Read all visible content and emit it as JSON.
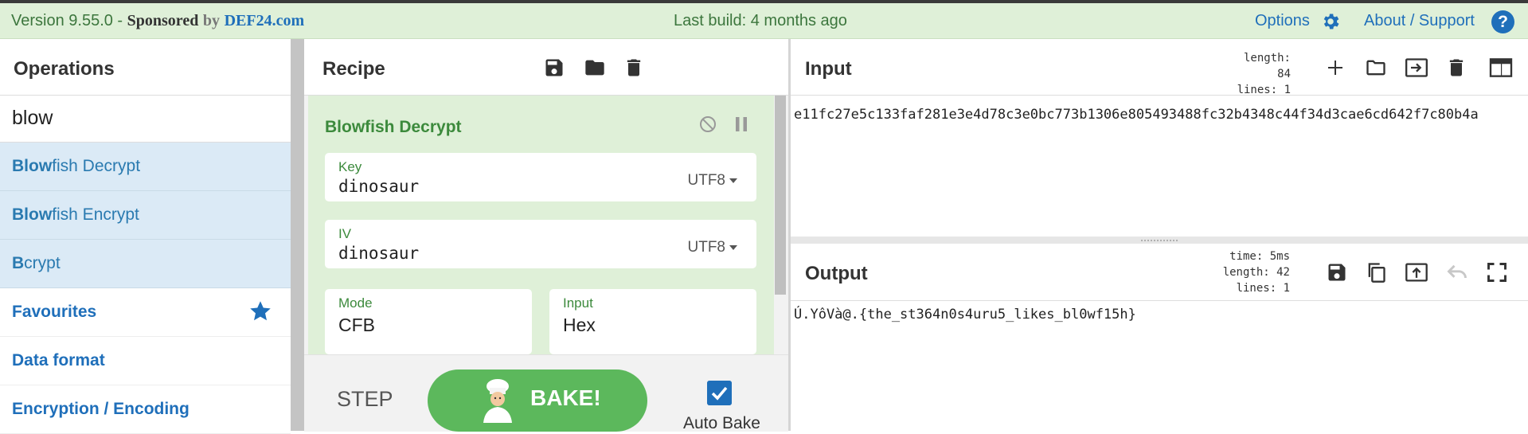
{
  "banner": {
    "version": "Version 9.55.0 - ",
    "sponsored": "Sponsored",
    "by": "by",
    "sponsor": "DEF24.com",
    "build": "Last build: 4 months ago",
    "options": "Options",
    "about": "About / Support",
    "help": "?"
  },
  "operations": {
    "title": "Operations",
    "search": "blow",
    "results": [
      {
        "match": "Blow",
        "rest": "fish Decrypt"
      },
      {
        "match": "Blow",
        "rest": "fish Encrypt"
      },
      {
        "match": "B",
        "rest": "crypt"
      }
    ],
    "categories": [
      "Favourites",
      "Data format",
      "Encryption / Encoding"
    ]
  },
  "recipe": {
    "title": "Recipe",
    "operation": {
      "title": "Blowfish Decrypt",
      "key": {
        "label": "Key",
        "value": "dinosaur",
        "encoding": "UTF8"
      },
      "iv": {
        "label": "IV",
        "value": "dinosaur",
        "encoding": "UTF8"
      },
      "mode": {
        "label": "Mode",
        "value": "CFB"
      },
      "input": {
        "label": "Input",
        "value": "Hex"
      }
    },
    "step_label": "STEP",
    "bake_label": "BAKE!",
    "auto_bake_label": "Auto Bake",
    "auto_bake_checked": true
  },
  "input": {
    "title": "Input",
    "length_line": "length: 84",
    "lines_line": "lines:  1",
    "text": "e11fc27e5c133faf281e3e4d78c3e0bc773b1306e805493488fc32b4348c44f34d3cae6cd642f7c80b4a"
  },
  "output": {
    "title": "Output",
    "time_line": "time:  5ms",
    "length_line": "length:  42",
    "lines_line": "lines:   1",
    "text": "Ú.YôVà@.{the_st364n0s4uru5_likes_bl0wf15h}"
  },
  "colors": {
    "banner_bg": "#dff0d8",
    "accent_blue": "#1f6fba",
    "bake_green": "#5cb85c",
    "operation_bg": "#dff0d8",
    "search_result_bg": "#dbeaf6"
  }
}
